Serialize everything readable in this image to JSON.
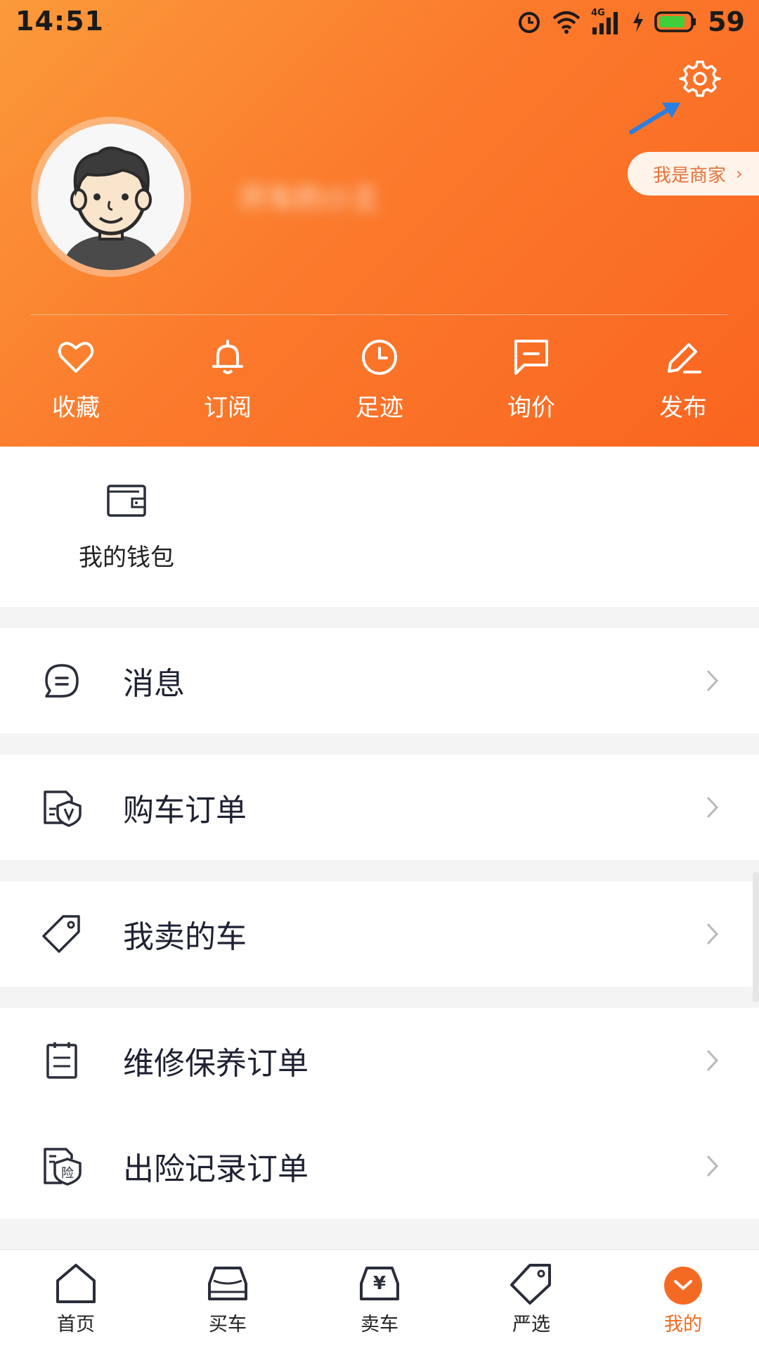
{
  "status_bar": {
    "time": "14:51",
    "network": "4G",
    "battery": "59"
  },
  "header": {
    "username": "开车的小王",
    "merchant_label": "我是商家",
    "merchant_chevron": "›"
  },
  "quick_actions": [
    {
      "label": "收藏",
      "icon": "heart-icon"
    },
    {
      "label": "订阅",
      "icon": "bell-icon"
    },
    {
      "label": "足迹",
      "icon": "clock-icon"
    },
    {
      "label": "询价",
      "icon": "chat-square-icon"
    },
    {
      "label": "发布",
      "icon": "pencil-icon"
    }
  ],
  "wallet": {
    "label": "我的钱包",
    "icon": "wallet-icon"
  },
  "menu": [
    {
      "label": "消息",
      "icon": "message-icon"
    },
    {
      "label": "购车订单",
      "icon": "purchase-order-icon"
    },
    {
      "label": "我卖的车",
      "icon": "price-tag-icon"
    },
    {
      "label": "维修保养订单",
      "icon": "maintenance-list-icon"
    },
    {
      "label": "出险记录订单",
      "icon": "insurance-record-icon"
    }
  ],
  "bottom_nav": [
    {
      "label": "首页",
      "icon": "home-icon"
    },
    {
      "label": "买车",
      "icon": "car-front-icon"
    },
    {
      "label": "卖车",
      "icon": "sell-car-icon"
    },
    {
      "label": "严选",
      "icon": "tag-icon"
    },
    {
      "label": "我的",
      "icon": "me-icon",
      "active": true
    }
  ],
  "colors": {
    "header_start": "#fb9a3a",
    "header_end": "#fa6520",
    "accent": "#f26a1f",
    "text_dark": "#1f2233"
  }
}
